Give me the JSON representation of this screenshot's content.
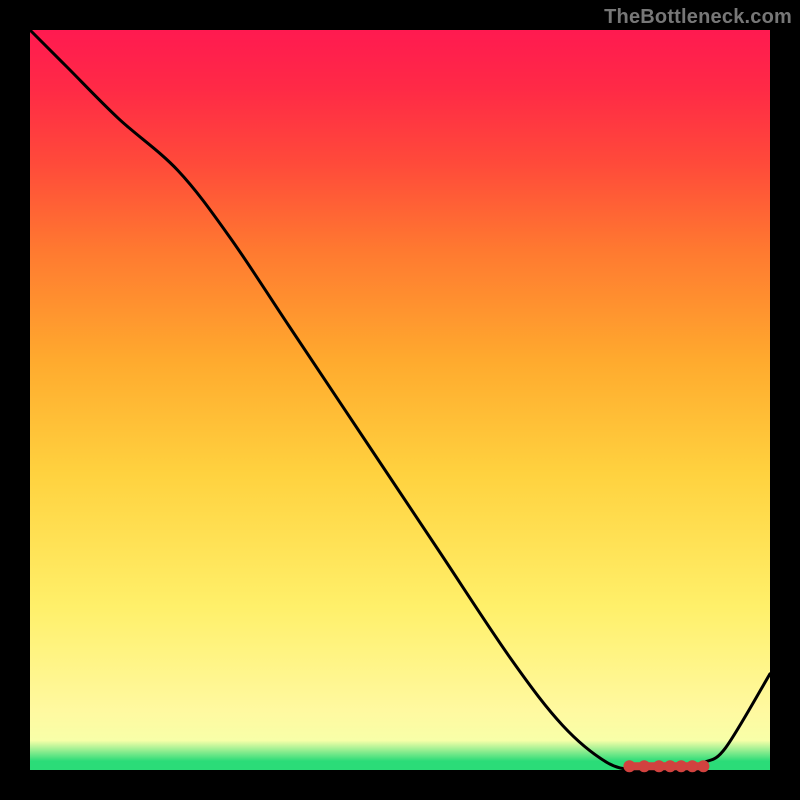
{
  "watermark": "TheBottleneck.com",
  "chart_data": {
    "type": "line",
    "title": "",
    "xlabel": "",
    "ylabel": "",
    "xlim": [
      0,
      100
    ],
    "ylim": [
      0,
      100
    ],
    "grid": false,
    "legend": false,
    "series": [
      {
        "name": "curve",
        "x": [
          0,
          5,
          12,
          20,
          27,
          35,
          45,
          55,
          65,
          72,
          78,
          82,
          85,
          88,
          91,
          94,
          100
        ],
        "y": [
          100,
          95,
          88,
          81,
          72,
          60,
          45,
          30,
          15,
          6,
          1,
          0,
          0,
          0,
          1,
          3,
          13
        ]
      }
    ],
    "markers": {
      "name": "optimal-range",
      "x": [
        81,
        83,
        85,
        86.5,
        88,
        89.5,
        91
      ],
      "y": [
        0.5,
        0.5,
        0.5,
        0.5,
        0.5,
        0.5,
        0.5
      ]
    },
    "gradient_stops": [
      {
        "pos": 0.0,
        "color": "#2bdc78"
      },
      {
        "pos": 0.012,
        "color": "#2bdc78"
      },
      {
        "pos": 0.04,
        "color": "#f8ffa8"
      },
      {
        "pos": 0.08,
        "color": "#fff9a0"
      },
      {
        "pos": 0.22,
        "color": "#fff06a"
      },
      {
        "pos": 0.4,
        "color": "#ffd23f"
      },
      {
        "pos": 0.55,
        "color": "#ffab2e"
      },
      {
        "pos": 0.7,
        "color": "#ff7a30"
      },
      {
        "pos": 0.82,
        "color": "#ff4a3a"
      },
      {
        "pos": 0.92,
        "color": "#ff2a46"
      },
      {
        "pos": 1.0,
        "color": "#ff1a50"
      }
    ]
  }
}
